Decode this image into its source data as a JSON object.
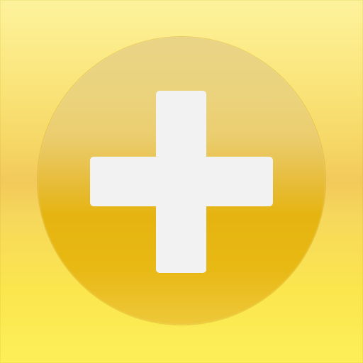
{
  "app_icon": {
    "name": "",
    "icon": "plus-icon",
    "colors": {
      "background_light": "#fdf29c",
      "background_mid": "#f2c95a",
      "background_bottom": "#fdef59",
      "disc_top": "#e9d386",
      "disc_bottom": "#e5b410",
      "plus": "#f2f2f2"
    }
  }
}
